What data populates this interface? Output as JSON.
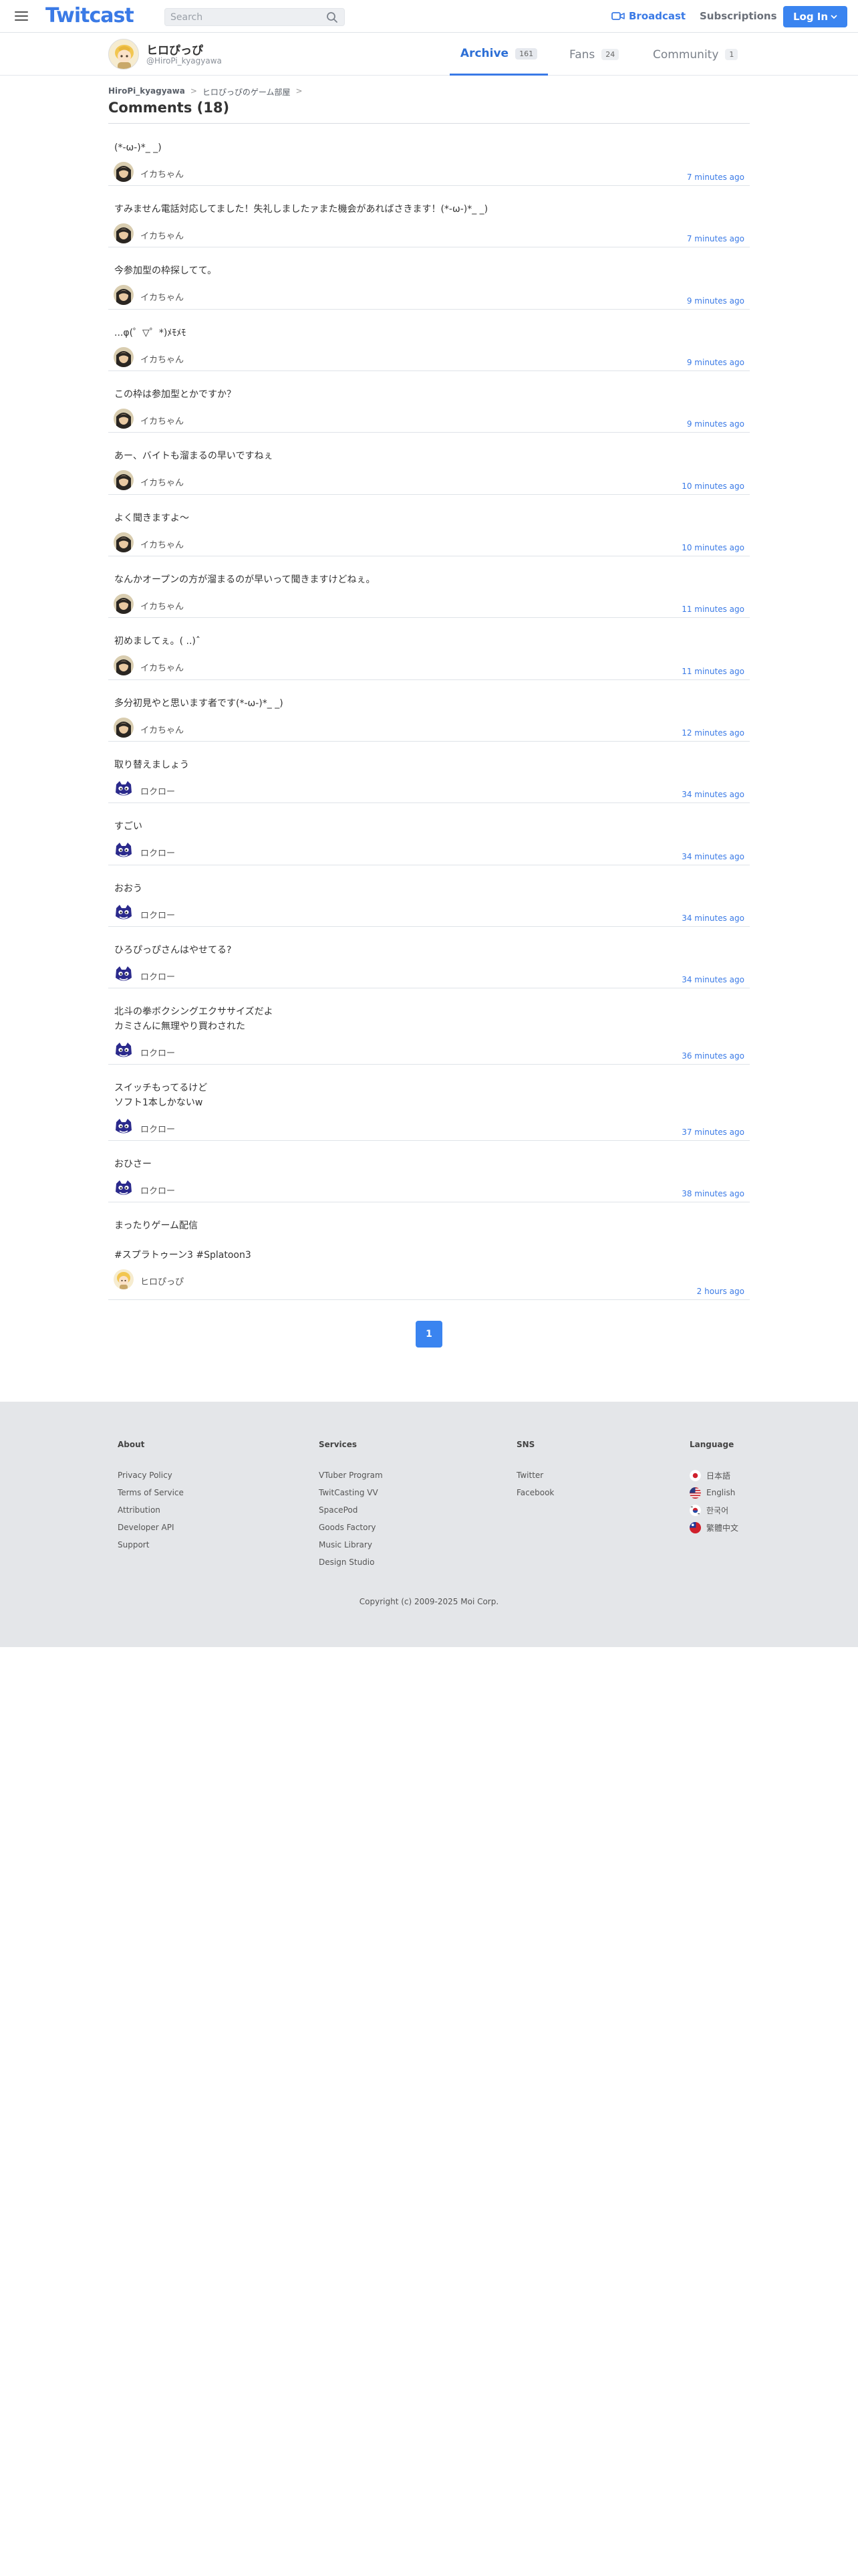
{
  "header": {
    "logo": "Twitcast",
    "search_placeholder": "Search",
    "broadcast_label": "Broadcast",
    "subscriptions_label": "Subscriptions",
    "login_label": "Log In"
  },
  "profile": {
    "name": "ヒロぴっぴ",
    "id": "@HiroPi_kyagyawa",
    "tabs": [
      {
        "label": "Archive",
        "count": "161"
      },
      {
        "label": "Fans",
        "count": "24"
      },
      {
        "label": "Community",
        "count": "1"
      }
    ]
  },
  "breadcrumb": {
    "items": [
      "HiroPi_kyagyawa",
      "ヒロぴっぴのゲーム部屋"
    ]
  },
  "page_title": "Comments (18)",
  "comments": [
    {
      "text": "(*-ω-)*_ _)",
      "user": "イカちゃん",
      "time": "7 minutes ago"
    },
    {
      "text": "すみません電話対応してました！失礼しましたァまた機会があればさきます！(*-ω-)*_ _)",
      "user": "イカちゃん",
      "time": "7 minutes ago"
    },
    {
      "text": "今参加型の枠探してて。",
      "user": "イカちゃん",
      "time": "9 minutes ago"
    },
    {
      "text": "...φ(゜▽゜*)ﾒﾓﾒﾓ",
      "user": "イカちゃん",
      "time": "9 minutes ago"
    },
    {
      "text": "この枠は参加型とかですか？",
      "user": "イカちゃん",
      "time": "9 minutes ago"
    },
    {
      "text": "あー、バイトも溜まるの早いですねぇ",
      "user": "イカちゃん",
      "time": "10 minutes ago"
    },
    {
      "text": "よく聞きますよ〜",
      "user": "イカちゃん",
      "time": "10 minutes ago"
    },
    {
      "text": "なんかオープンの方が溜まるのが早いって聞きますけどねぇ。",
      "user": "イカちゃん",
      "time": "11 minutes ago"
    },
    {
      "text": "初めましてぇ。( ..)ˆ",
      "user": "イカちゃん",
      "time": "11 minutes ago"
    },
    {
      "text": "多分初見やと思います者です(*-ω-)*_ _)",
      "user": "イカちゃん",
      "time": "12 minutes ago"
    },
    {
      "text": "取り替えましょう",
      "user": "ロクロー",
      "time": "34 minutes ago"
    },
    {
      "text": "すごい",
      "user": "ロクロー",
      "time": "34 minutes ago"
    },
    {
      "text": "おおう",
      "user": "ロクロー",
      "time": "34 minutes ago"
    },
    {
      "text": "ひろぴっぴさんはやせてる?",
      "user": "ロクロー",
      "time": "34 minutes ago"
    },
    {
      "text": "北斗の拳ボクシングエクササイズだよ\nカミさんに無理やり買わされた",
      "user": "ロクロー",
      "time": "36 minutes ago"
    },
    {
      "text": "スイッチもってるけど\nソフト1本しかないw",
      "user": "ロクロー",
      "time": "37 minutes ago"
    },
    {
      "text": "おひさー",
      "user": "ロクロー",
      "time": "38 minutes ago"
    },
    {
      "text": "まったりゲーム配信\n\n#スプラトゥーン3 #Splatoon3",
      "user": "ヒロぴっぴ",
      "time": "2 hours ago"
    }
  ],
  "pagination": {
    "current": "1"
  },
  "footer": {
    "about": {
      "heading": "About",
      "links": [
        "Privacy Policy",
        "Terms of Service",
        "Attribution",
        "Developer API",
        "Support"
      ]
    },
    "services": {
      "heading": "Services",
      "links": [
        "VTuber Program",
        "TwitCasting VV",
        "SpacePod",
        "Goods Factory",
        "Music Library",
        "Design Studio"
      ]
    },
    "sns": {
      "heading": "SNS",
      "links": [
        "Twitter",
        "Facebook"
      ]
    },
    "language": {
      "heading": "Language",
      "links": [
        "日本語",
        "English",
        "한국어",
        "繁體中文"
      ]
    },
    "copyright": "Copyright (c) 2009-2025 Moi Corp."
  },
  "colors": {
    "accent": "#3a7ae6",
    "button": "#3a84f0",
    "footer_bg": "#e4e6e9"
  }
}
